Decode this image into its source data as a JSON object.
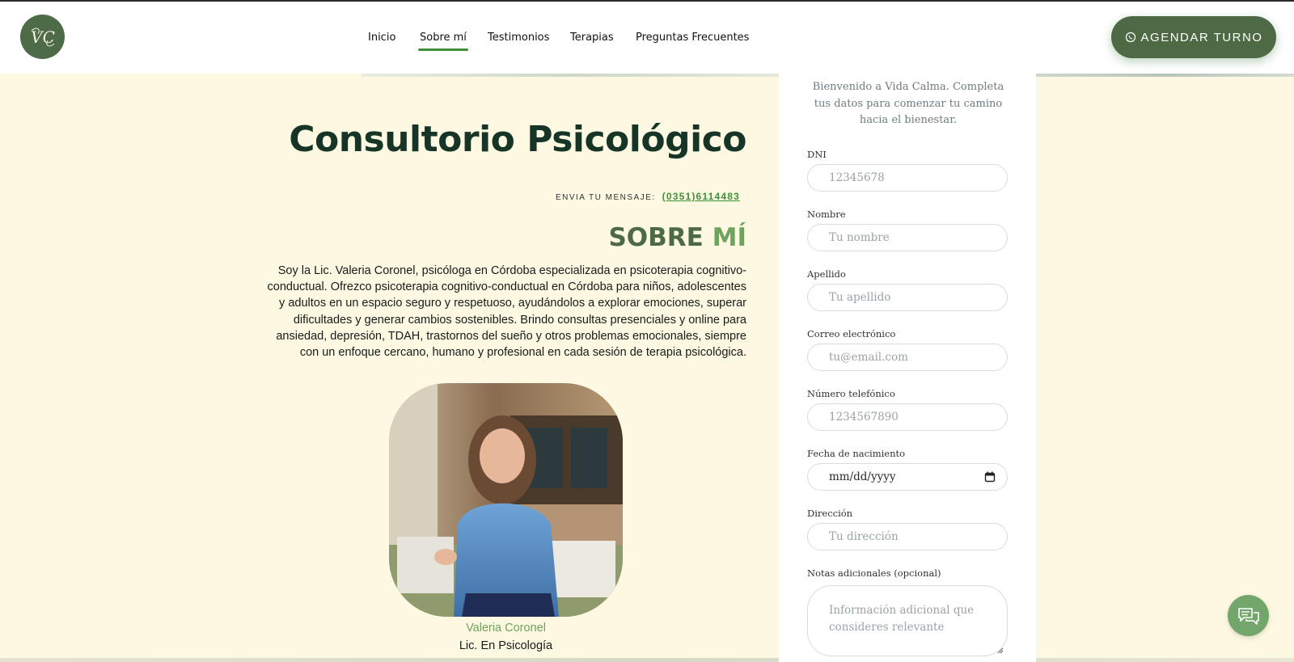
{
  "header": {
    "logo_text": "VC",
    "nav": [
      "Inicio",
      "Sobre mí",
      "Testimonios",
      "Terapias",
      "Preguntas Frecuentes"
    ],
    "active_nav": "Sobre mí",
    "cta_label": "AGENDAR TURNO"
  },
  "hero": {
    "title": "Consultorio Psicológico",
    "contact_label": "ENVIA TU MENSAJE:",
    "phone": "(0351)6114483"
  },
  "about": {
    "title_part1": "SOBRE",
    "title_part2": "MÍ",
    "paragraph": "Soy la Lic. Valeria Coronel, psicóloga en Córdoba especializada en psicoterapia cognitivo-conductual. Ofrezco psicoterapia cognitivo-conductual en Córdoba para niños, adolescentes y adultos en un espacio seguro y respetuoso, ayudándolos a explorar emociones, superar dificultades y generar cambios sostenibles. Brindo consultas presenciales y online para ansiedad, depresión, TDAH, trastornos del sueño y otros problemas emocionales, siempre con un enfoque cercano, humano y profesional en cada sesión de terapia psicológica.",
    "photo_name": "Valeria Coronel",
    "photo_role": "Lic. En Psicología"
  },
  "form": {
    "welcome": "Bienvenido a Vida Calma. Completa tus datos para comenzar tu camino hacia el bienestar.",
    "fields": [
      {
        "label": "DNI",
        "placeholder": "12345678"
      },
      {
        "label": "Nombre",
        "placeholder": "Tu nombre"
      },
      {
        "label": "Apellido",
        "placeholder": "Tu apellido"
      },
      {
        "label": "Correo electrónico",
        "placeholder": "tu@email.com"
      },
      {
        "label": "Número telefónico",
        "placeholder": "1234567890"
      },
      {
        "label": "Fecha de nacimiento",
        "placeholder": "mm/dd/yyyy"
      },
      {
        "label": "Dirección",
        "placeholder": "Tu dirección"
      },
      {
        "label": "Notas adicionales (opcional)",
        "placeholder": "Información adicional que consideres relevante"
      }
    ]
  },
  "icons": {
    "cta": "whatsapp-icon",
    "chat": "chat-icon",
    "date": "calendar-icon"
  },
  "colors": {
    "brand_dark": "#4d6a44",
    "accent_green": "#3f8f3a",
    "light_green": "#6fa35e",
    "cream_bg": "#fdf8e1",
    "title_green": "#163526"
  }
}
